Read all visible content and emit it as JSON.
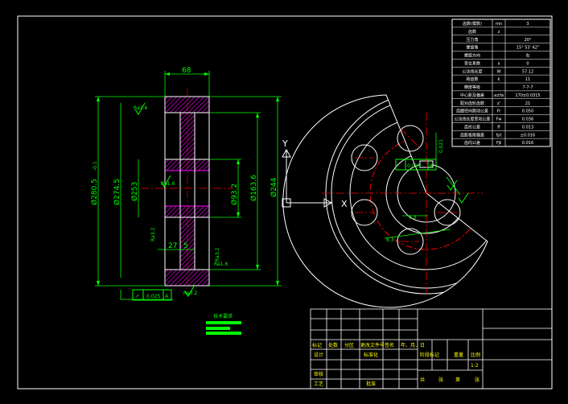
{
  "colors": {
    "background": "#000000",
    "outline": "#ffffff",
    "dimension": "#00ff00",
    "centerline": "#ff0000",
    "hatch": "#ff00ff",
    "title_text": "#ffff00"
  },
  "side_view": {
    "dims": {
      "width_top": "68",
      "d_tip": "Ø280.5",
      "d_tip_tol": "-0.1",
      "d_root": "Ø274.5",
      "d_web_inner": "Ø253",
      "d_web_inner_sup": "52",
      "d_bore": "Ø93.2",
      "d_hub": "Ø163.6",
      "d_rim": "Ø244",
      "hub_offset": "27",
      "hub_offset2": "5"
    },
    "roughness": [
      "Ra1.6",
      "Ra1.6",
      "Ra3.2",
      "Ra3.2",
      "Ra1.6",
      "Ra3.2"
    ],
    "tolerance_frame": {
      "symbol": "↗",
      "value": "0.025",
      "datum": "A"
    }
  },
  "front_view": {
    "axis_x": "X",
    "axis_y": "Y",
    "tolerance_frame": {
      "value": "0.025",
      "datum": "A"
    },
    "keyway_dim": "0.021",
    "angle_dims": [
      "6.3",
      "6.3"
    ]
  },
  "spec_table": {
    "rows": [
      {
        "label": "齿数(模数)",
        "symbol": "mn",
        "value": "3"
      },
      {
        "label": "齿数",
        "symbol": "z",
        "value": ""
      },
      {
        "label": "压力角",
        "symbol": "",
        "value": "20°"
      },
      {
        "label": "螺旋角",
        "symbol": "",
        "value": "15° 53' 42\""
      },
      {
        "label": "螺旋方向",
        "symbol": "",
        "value": "右"
      },
      {
        "label": "变位系数",
        "symbol": "x",
        "value": "0"
      },
      {
        "label": "公法线长度",
        "symbol": "W",
        "value": "57.12"
      },
      {
        "label": "跨齿数",
        "symbol": "k",
        "value": "11"
      },
      {
        "label": "精度等级",
        "symbol": "",
        "value": "7-7-7"
      },
      {
        "label": "中心距及偏差",
        "symbol": "a±fa",
        "value": "170±0.0315"
      },
      {
        "label": "配对齿轮齿数",
        "symbol": "z'",
        "value": "21"
      },
      {
        "label": "齿圈径向跳动公差",
        "symbol": "Fr",
        "value": "0.050"
      },
      {
        "label": "公法线长度变动公差",
        "symbol": "Fw",
        "value": "0.036"
      },
      {
        "label": "齿形公差",
        "symbol": "ff",
        "value": "0.013"
      },
      {
        "label": "齿距极限偏差",
        "symbol": "fpt",
        "value": "±0.016"
      },
      {
        "label": "齿向公差",
        "symbol": "Fβ",
        "value": "0.016"
      }
    ]
  },
  "tech_requirements": {
    "title": "技术要求"
  },
  "title_block": {
    "labels": {
      "mark": "标记",
      "count": "处数",
      "zone": "分区",
      "doc_no": "更改文件号",
      "sign": "签名",
      "date": "年、月、日",
      "design": "设计",
      "standard": "标准化",
      "stage_mark": "阶段标记",
      "weight": "重量",
      "scale": "比例",
      "scale_value": "1:2",
      "review": "审核",
      "process": "工艺",
      "approve": "批准",
      "total": "共",
      "sheet": "张",
      "of": "第",
      "sheet2": "张"
    }
  }
}
